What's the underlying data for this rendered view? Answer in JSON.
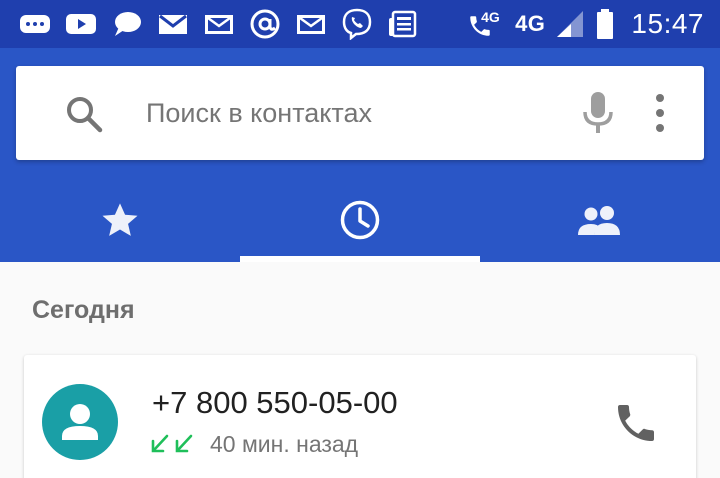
{
  "status_bar": {
    "notification_icons": [
      "messenger-icon",
      "youtube-icon",
      "chat-bubble-icon",
      "gmail-icon",
      "mail-icon",
      "at-sign-icon",
      "mail-icon",
      "viber-icon",
      "news-icon"
    ],
    "network_call_label": "4G",
    "network_label": "4G",
    "time": "15:47"
  },
  "search": {
    "placeholder": "Поиск в контактах"
  },
  "tabs": [
    {
      "name": "favorites",
      "icon": "star-icon",
      "selected": false
    },
    {
      "name": "recents",
      "icon": "clock-icon",
      "selected": true
    },
    {
      "name": "contacts",
      "icon": "people-icon",
      "selected": false
    }
  ],
  "recents": {
    "section_title": "Сегодня",
    "items": [
      {
        "number": "+7 800 550-05-00",
        "time_ago": "40 мин. назад",
        "call_type": "incoming",
        "call_count": 2
      }
    ]
  },
  "colors": {
    "status_bar": "#1f3fae",
    "app_bar": "#2a56c6",
    "avatar": "#1a9fa6",
    "incoming_arrow": "#1fbf5a"
  }
}
